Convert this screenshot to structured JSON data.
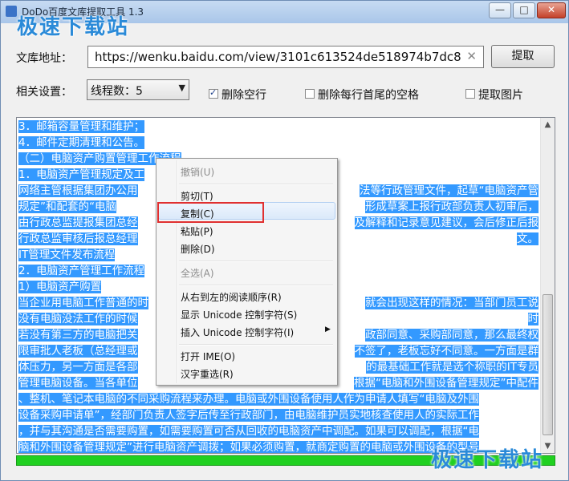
{
  "window": {
    "title": "DoDo百度文库提取工具 1.3",
    "watermark": "极速下载站",
    "controls": {
      "minimize": "—",
      "maximize": "□",
      "close": "✕"
    }
  },
  "form": {
    "url_label": "文库地址：",
    "url_value": "https://wenku.baidu.com/view/3101c613524de518974b7dc8",
    "clear_glyph": "✕",
    "extract_button": "提取",
    "settings_label": "相关设置：",
    "threads_select": "线程数：5",
    "checkboxes": [
      {
        "label": "删除空行",
        "checked": true
      },
      {
        "label": "删除每行首尾的空格",
        "checked": false
      },
      {
        "label": "提取图片",
        "checked": false
      }
    ]
  },
  "content": {
    "lines": [
      "3．邮箱容量管理和维护；",
      "4．邮件定期清理和公告。",
      "（二）电脑资产购置管理工作流程",
      "1．电脑资产管理规定及工",
      "网络主管根据集团办公用",
      "规定”和配套的“电脑",
      "由行政总监提报集团总经",
      "行政总监审核后报总经理",
      "IT管理文件发布流程",
      "2．电脑资产管理工作流程",
      "1）电脑资产购置",
      "当企业用电脑工作普通的时",
      "没有电脑没法工作的时候",
      "若没有第三方的电脑把关",
      "限审批人老板（总经理或",
      "体压力，另一方面是各部",
      "管理电脑设备。当各单位",
      "、整机、笔记本电脑的不同采购流程来办理。电脑或外围设备使用人作为申请人填写“电脑及外围",
      "设备采购申请单”，经部门负责人签字后传至行政部门，由电脑维护员实地核查使用人的实际工作",
      "，并与其沟通是否需要购置，如需要购置可否从回收的电脑资产中调配。如果可以调配，根据“电",
      "脑和外围设备管理规定”进行电脑资产调拨；如果必须购置，就商定购置的电脑或外围设备的型号"
    ],
    "right_fragments": [
      {
        "row": 4,
        "text": "法等行政管理文件，起草“电脑资产管"
      },
      {
        "row": 5,
        "text": "形成草案上报行政部负责人初审后，"
      },
      {
        "row": 6,
        "text": "及解释和记录意见建议，会后修正后报"
      },
      {
        "row": 7,
        "text": "文。"
      },
      {
        "row": 11,
        "text": "就会出现这样的情况：当部门员工说"
      },
      {
        "row": 12,
        "text": "时"
      },
      {
        "row": 13,
        "text": "政部同意、采购部同意，那么最终权"
      },
      {
        "row": 14,
        "text": "不签了，老板忘好不同意。一方面是群"
      },
      {
        "row": 15,
        "text": "的最基础工作就是选个称职的IT专员"
      },
      {
        "row": 16,
        "text": "根据“电脑和外围设备管理规定”中配件"
      }
    ],
    "progress": 1.0
  },
  "context_menu": {
    "items": [
      {
        "label": "撤销(U)",
        "disabled": true
      },
      {
        "label": "剪切(T)",
        "disabled": false
      },
      {
        "label": "复制(C)",
        "disabled": false,
        "highlighted": true
      },
      {
        "label": "粘贴(P)",
        "disabled": false
      },
      {
        "label": "删除(D)",
        "disabled": false
      },
      {
        "label": "全选(A)",
        "disabled": true
      },
      {
        "label": "从右到左的阅读顺序(R)",
        "disabled": false
      },
      {
        "label": "显示 Unicode 控制字符(S)",
        "disabled": false
      },
      {
        "label": "插入 Unicode 控制字符(I)",
        "disabled": false,
        "submenu": true
      },
      {
        "label": "打开 IME(O)",
        "disabled": false
      },
      {
        "label": "汉字重选(R)",
        "disabled": false
      }
    ],
    "submenu_arrow": "▶"
  },
  "scrollbar": {
    "up": "▲",
    "down": "▼"
  },
  "colors": {
    "selection": "#3399ff",
    "progress": "#20d020",
    "highlight_border": "#e03030",
    "watermark": "#2a8ad8"
  }
}
